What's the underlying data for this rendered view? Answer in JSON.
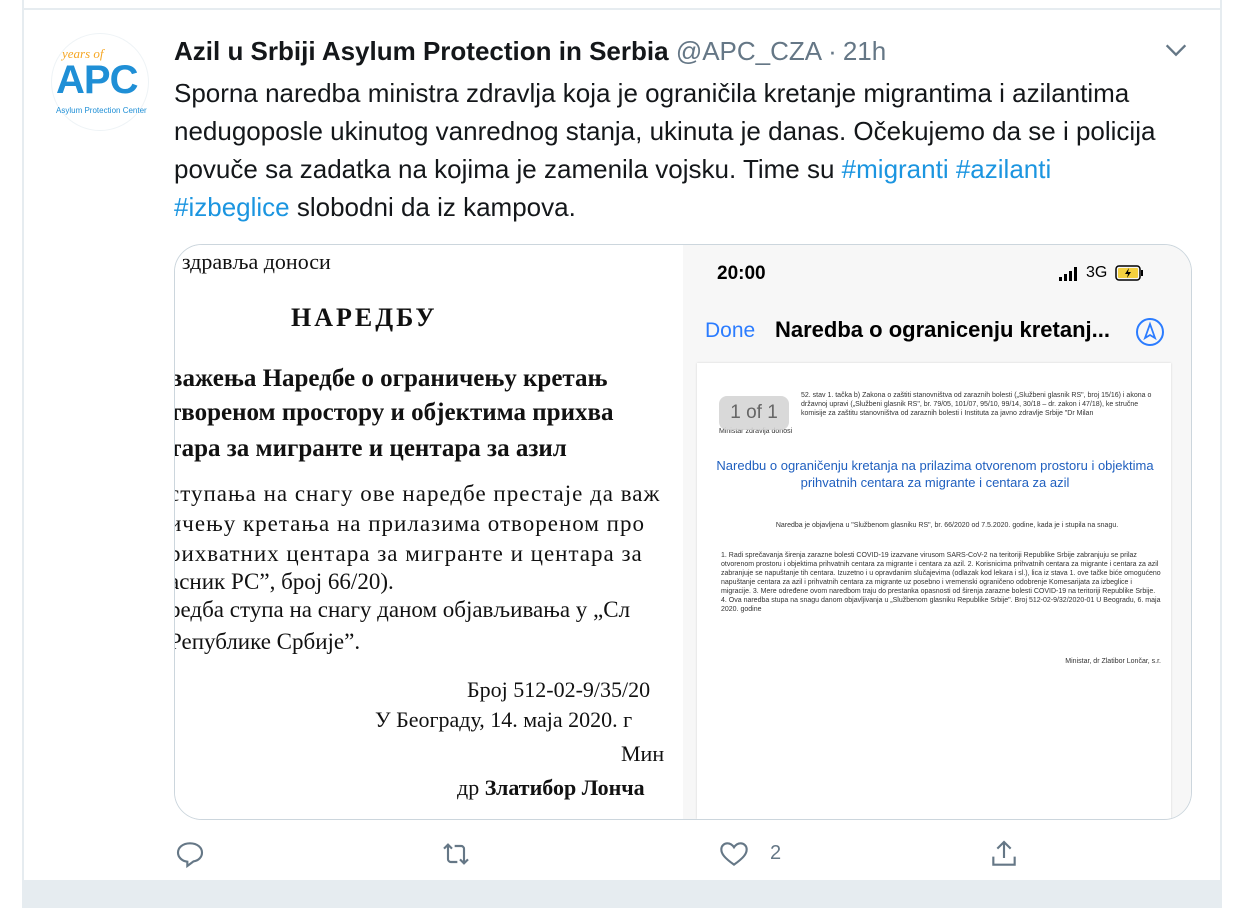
{
  "tweet": {
    "author_name": "Azil u Srbiji Asylum Protection in Serbia",
    "handle": "@APC_CZA",
    "separator": "·",
    "time": "21h",
    "avatar": {
      "years": "years of",
      "logo": "APC",
      "subtitle": "Asylum Protection Center"
    },
    "text_part1": "Sporna naredba ministra zdravlja koja je ograničila kretanje migrantima i azilantima nedugoposle ukinutog vanrednog stanja, ukinuta je danas. Očekujemo da se i policija povuče sa zadatka na kojima je zamenila vojsku. Time su ",
    "hashtags": [
      "#migranti",
      "#azilanti",
      "#izbeglice"
    ],
    "text_part2": " slobodni da iz kampova.",
    "like_count": "2",
    "colors": {
      "link": "#1b95e0",
      "text": "#14171a",
      "muted": "#657786"
    }
  },
  "media_left": {
    "lines": [
      "› здравља доноси",
      "НАРЕДБУ",
      "важења Наредбе о ограничењу кретањ",
      "твореном простору и објектима прихва",
      "тара за мигранте и центара за азил",
      "ступања на снагу ове наредбе престаје да важ",
      "ичењу кретања на прилазима отвореном про",
      "рихватних центара за мигранте и центара за",
      "асник РС”, број 66/20).",
      "редба ступа на снагу даном објављивања у „Сл",
      "Републике Србије”.",
      "Број 512-02-9/35/20",
      "У Београду, 14. маја 2020. г",
      "Мин",
      "др ",
      "Златибор Лонча"
    ]
  },
  "media_right": {
    "status_time": "20:00",
    "network": "3G",
    "done_label": "Done",
    "nav_title": "Naredba o ogranicenju kretanj...",
    "page_count": "1 of 1",
    "page_top": "52. stav 1. tačka b) Zakona o zaštiti stanovništva od zaraznih bolesti („Službeni glasnik RS\", broj 15/16) i akona o državnoj upravi („Službeni glasnik RS\", br. 79/05, 101/07, 95/10, 99/14, 30/18 – dr. zakon i 47/18), ke stručne komisije za zaštitu stanovništva od zaraznih bolesti i Instituta za javno zdravlje Srbije \"Dr Milan",
    "page_minister_line": "Ministar zdravlja donosi",
    "page_title": "Naredbu o ograničenju kretanja na prilazima otvorenom prostoru i objektima prihvatnih centara za migrante i centara za azil",
    "page_published": "Naredba je objavljena u \"Službenom glasniku RS\", br. 66/2020 od 7.5.2020. godine, kada je i stupila na snagu.",
    "page_body": "1. Radi sprečavanja širenja zarazne bolesti COVID-19 izazvane virusom SARS-CoV-2 na teritoriji Republike Srbije zabranjuju se prilaz otvorenom prostoru i objektima prihvatnih centara za migrante i centara za azil. 2. Korisnicima prihvatnih centara za migrante i centara za azil zabranjuje se napuštanje tih centara. Izuzetno i u opravdanim slučajevima (odlazak kod lekara i sl.), lica iz stava 1. ove tačke biće omogućeno napuštanje centara za azil i prihvatnih centara za migrante uz posebno i vremenski ograničeno odobrenje Komesarijata za izbeglice i migracije. 3. Mere određene ovom naredbom traju do prestanka opasnosti od širenja zarazne bolesti COVID-19 na teritoriji Republike Srbije. 4. Ova naredba stupa na snagu danom objavljivanja u „Službenom glasniku Republike Srbije\". Broj 512-02-9/32/2020-01 U Beogradu, 6. maja 2020. godine",
    "page_sign": "Ministar, dr Zlatibor Lončar, s.r.",
    "colors": {
      "done": "#2b7cff",
      "title": "#1f5fbf"
    }
  },
  "icons": {
    "caret": "chevron-down-icon",
    "reply": "reply-icon",
    "retweet": "retweet-icon",
    "like": "heart-icon",
    "share": "share-icon"
  }
}
